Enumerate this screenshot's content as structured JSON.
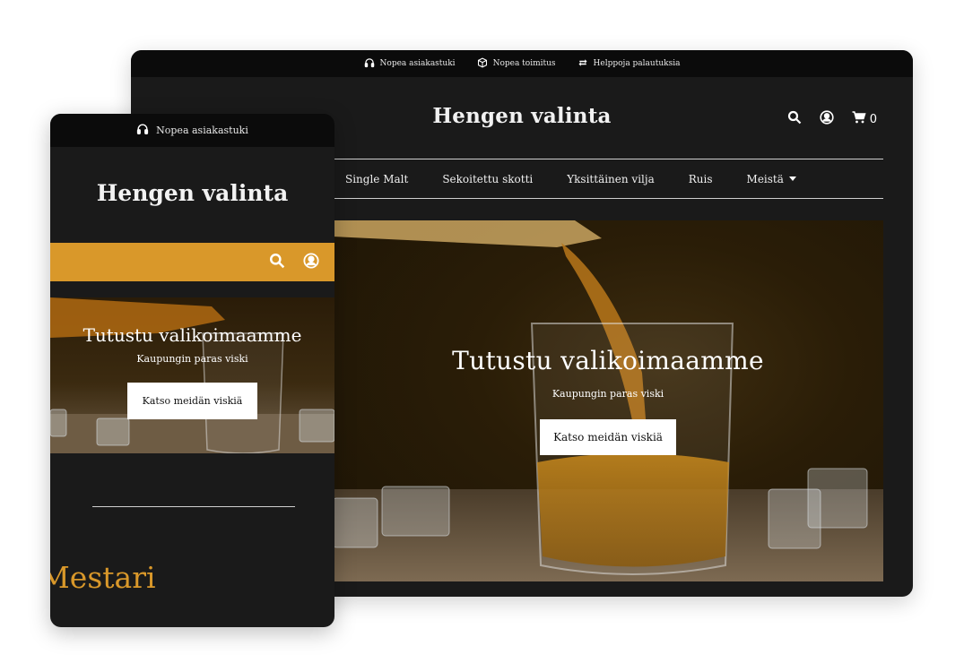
{
  "desktop": {
    "announcement": [
      {
        "icon": "headset-icon",
        "text": "Nopea asiakastuki"
      },
      {
        "icon": "box-icon",
        "text": "Nopea toimitus"
      },
      {
        "icon": "swap-arrows-icon",
        "text": "Helppoja palautuksia"
      }
    ],
    "site_title": "Hengen valinta",
    "cart_count": "0",
    "nav": [
      "Single Malt",
      "Sekoitettu skotti",
      "Yksittäinen vilja",
      "Ruis",
      "Meistä"
    ],
    "hero": {
      "title": "Tutustu valikoimaamme",
      "subtitle": "Kaupungin paras viski",
      "button": "Katso meidän viskiä"
    }
  },
  "mobile": {
    "announcement": {
      "icon": "headset-icon",
      "text": "Nopea asiakastuki"
    },
    "site_title": "Hengen valinta",
    "hero": {
      "title": "Tutustu valikoimaamme",
      "subtitle": "Kaupungin paras viski",
      "button": "Katso meidän viskiä"
    },
    "section_heading": "Mestari"
  },
  "colors": {
    "background_dark": "#1a1a1a",
    "announcement_bar": "#0b0b0b",
    "accent": "#d9982a",
    "text_light": "#f2f2f2"
  }
}
